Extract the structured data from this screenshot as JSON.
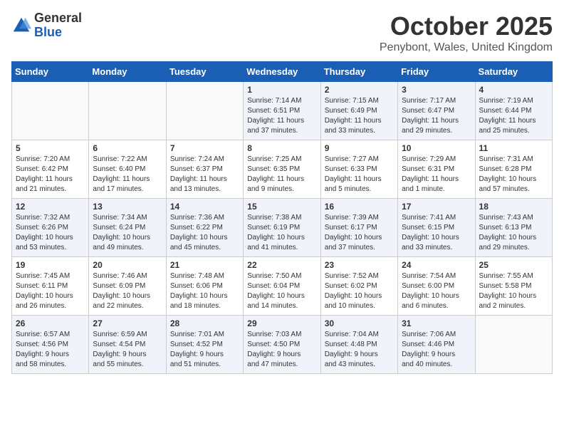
{
  "header": {
    "logo_general": "General",
    "logo_blue": "Blue",
    "month": "October 2025",
    "location": "Penybont, Wales, United Kingdom"
  },
  "days_of_week": [
    "Sunday",
    "Monday",
    "Tuesday",
    "Wednesday",
    "Thursday",
    "Friday",
    "Saturday"
  ],
  "weeks": [
    [
      {
        "day": "",
        "info": ""
      },
      {
        "day": "",
        "info": ""
      },
      {
        "day": "",
        "info": ""
      },
      {
        "day": "1",
        "info": "Sunrise: 7:14 AM\nSunset: 6:51 PM\nDaylight: 11 hours\nand 37 minutes."
      },
      {
        "day": "2",
        "info": "Sunrise: 7:15 AM\nSunset: 6:49 PM\nDaylight: 11 hours\nand 33 minutes."
      },
      {
        "day": "3",
        "info": "Sunrise: 7:17 AM\nSunset: 6:47 PM\nDaylight: 11 hours\nand 29 minutes."
      },
      {
        "day": "4",
        "info": "Sunrise: 7:19 AM\nSunset: 6:44 PM\nDaylight: 11 hours\nand 25 minutes."
      }
    ],
    [
      {
        "day": "5",
        "info": "Sunrise: 7:20 AM\nSunset: 6:42 PM\nDaylight: 11 hours\nand 21 minutes."
      },
      {
        "day": "6",
        "info": "Sunrise: 7:22 AM\nSunset: 6:40 PM\nDaylight: 11 hours\nand 17 minutes."
      },
      {
        "day": "7",
        "info": "Sunrise: 7:24 AM\nSunset: 6:37 PM\nDaylight: 11 hours\nand 13 minutes."
      },
      {
        "day": "8",
        "info": "Sunrise: 7:25 AM\nSunset: 6:35 PM\nDaylight: 11 hours\nand 9 minutes."
      },
      {
        "day": "9",
        "info": "Sunrise: 7:27 AM\nSunset: 6:33 PM\nDaylight: 11 hours\nand 5 minutes."
      },
      {
        "day": "10",
        "info": "Sunrise: 7:29 AM\nSunset: 6:31 PM\nDaylight: 11 hours\nand 1 minute."
      },
      {
        "day": "11",
        "info": "Sunrise: 7:31 AM\nSunset: 6:28 PM\nDaylight: 10 hours\nand 57 minutes."
      }
    ],
    [
      {
        "day": "12",
        "info": "Sunrise: 7:32 AM\nSunset: 6:26 PM\nDaylight: 10 hours\nand 53 minutes."
      },
      {
        "day": "13",
        "info": "Sunrise: 7:34 AM\nSunset: 6:24 PM\nDaylight: 10 hours\nand 49 minutes."
      },
      {
        "day": "14",
        "info": "Sunrise: 7:36 AM\nSunset: 6:22 PM\nDaylight: 10 hours\nand 45 minutes."
      },
      {
        "day": "15",
        "info": "Sunrise: 7:38 AM\nSunset: 6:19 PM\nDaylight: 10 hours\nand 41 minutes."
      },
      {
        "day": "16",
        "info": "Sunrise: 7:39 AM\nSunset: 6:17 PM\nDaylight: 10 hours\nand 37 minutes."
      },
      {
        "day": "17",
        "info": "Sunrise: 7:41 AM\nSunset: 6:15 PM\nDaylight: 10 hours\nand 33 minutes."
      },
      {
        "day": "18",
        "info": "Sunrise: 7:43 AM\nSunset: 6:13 PM\nDaylight: 10 hours\nand 29 minutes."
      }
    ],
    [
      {
        "day": "19",
        "info": "Sunrise: 7:45 AM\nSunset: 6:11 PM\nDaylight: 10 hours\nand 26 minutes."
      },
      {
        "day": "20",
        "info": "Sunrise: 7:46 AM\nSunset: 6:09 PM\nDaylight: 10 hours\nand 22 minutes."
      },
      {
        "day": "21",
        "info": "Sunrise: 7:48 AM\nSunset: 6:06 PM\nDaylight: 10 hours\nand 18 minutes."
      },
      {
        "day": "22",
        "info": "Sunrise: 7:50 AM\nSunset: 6:04 PM\nDaylight: 10 hours\nand 14 minutes."
      },
      {
        "day": "23",
        "info": "Sunrise: 7:52 AM\nSunset: 6:02 PM\nDaylight: 10 hours\nand 10 minutes."
      },
      {
        "day": "24",
        "info": "Sunrise: 7:54 AM\nSunset: 6:00 PM\nDaylight: 10 hours\nand 6 minutes."
      },
      {
        "day": "25",
        "info": "Sunrise: 7:55 AM\nSunset: 5:58 PM\nDaylight: 10 hours\nand 2 minutes."
      }
    ],
    [
      {
        "day": "26",
        "info": "Sunrise: 6:57 AM\nSunset: 4:56 PM\nDaylight: 9 hours\nand 58 minutes."
      },
      {
        "day": "27",
        "info": "Sunrise: 6:59 AM\nSunset: 4:54 PM\nDaylight: 9 hours\nand 55 minutes."
      },
      {
        "day": "28",
        "info": "Sunrise: 7:01 AM\nSunset: 4:52 PM\nDaylight: 9 hours\nand 51 minutes."
      },
      {
        "day": "29",
        "info": "Sunrise: 7:03 AM\nSunset: 4:50 PM\nDaylight: 9 hours\nand 47 minutes."
      },
      {
        "day": "30",
        "info": "Sunrise: 7:04 AM\nSunset: 4:48 PM\nDaylight: 9 hours\nand 43 minutes."
      },
      {
        "day": "31",
        "info": "Sunrise: 7:06 AM\nSunset: 4:46 PM\nDaylight: 9 hours\nand 40 minutes."
      },
      {
        "day": "",
        "info": ""
      }
    ]
  ]
}
